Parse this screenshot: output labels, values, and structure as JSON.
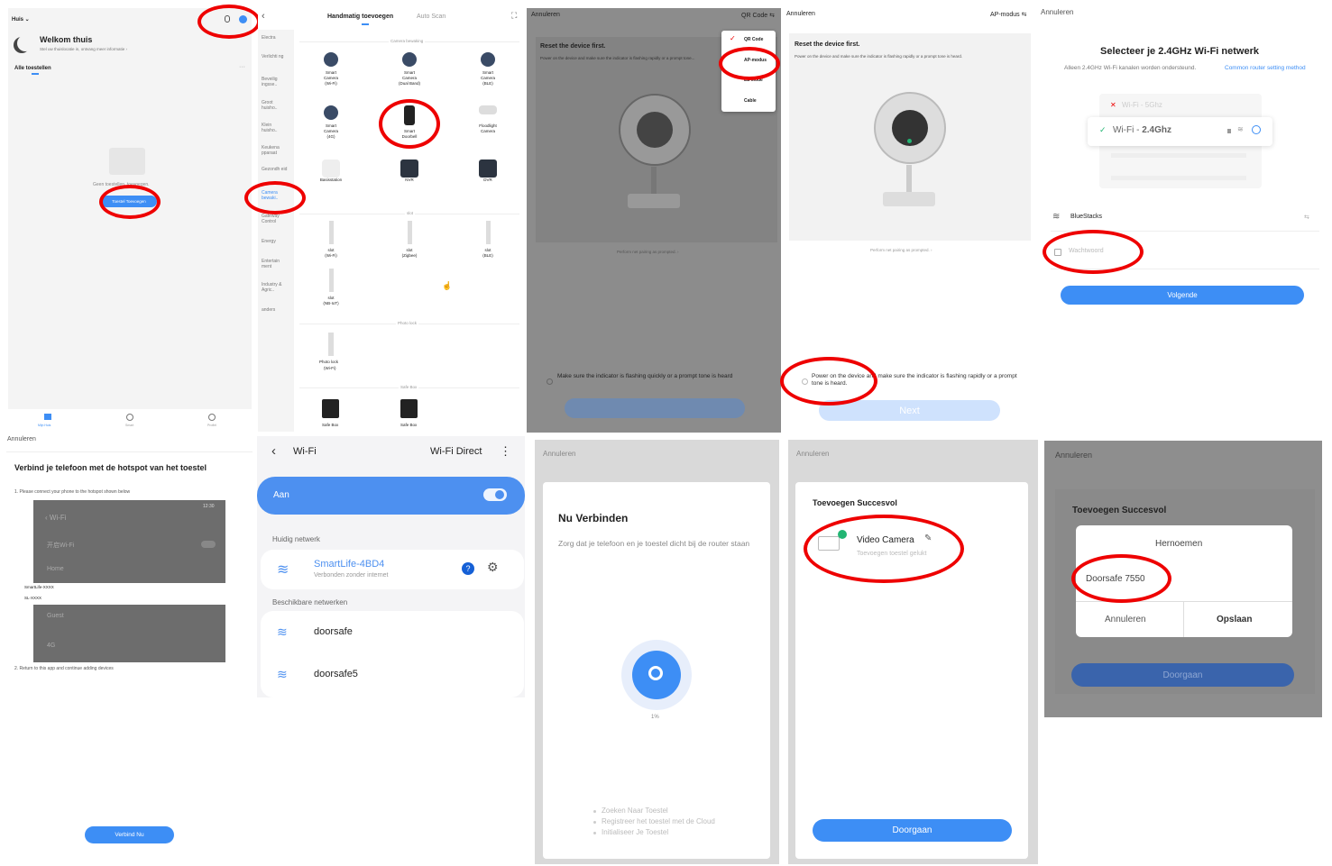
{
  "p1": {
    "home": "Huis ⌄",
    "welcome": "Welkom thuis",
    "sub": "Stel uw thuislocatie in, ontvang meer informatie ›",
    "all": "Alle toestellen",
    "more": "···",
    "empty": "Geen toestellen, toevoegen.",
    "add_btn": "Toestel Toevoegen",
    "nav": [
      "Mijn Huis",
      "Smart",
      "Profiel"
    ]
  },
  "p2": {
    "tab_manual": "Handmatig toevoegen",
    "tab_auto": "Auto Scan",
    "cats": [
      "Electra",
      "Verlichti ng",
      "Beveilig ingsse..",
      "Groot huisho..",
      "Klein huisho..",
      "Keukena pparaat",
      "Gezondh eid",
      "Camera bewaki..",
      "Gateway Control",
      "Energy",
      "Entertain ment",
      "Industry & Agric..",
      "anders"
    ],
    "sec_cam": "Camera bewaking",
    "devices": [
      [
        "Smart",
        "Camera",
        "(Wi-Fi)"
      ],
      [
        "Smart",
        "Camera",
        "(Dual Band)"
      ],
      [
        "Smart",
        "Camera",
        "(BLE)"
      ],
      [
        "Smart",
        "Camera",
        "(4G)"
      ],
      [
        "Smart",
        "Doorbell"
      ],
      [
        "Floodlight",
        "Camera"
      ],
      [
        "Basisstation"
      ],
      [
        "NVR"
      ],
      [
        "DVR"
      ]
    ],
    "sec_slot": "slot",
    "slots": [
      [
        "slot",
        "(Wi-Fi)"
      ],
      [
        "slot",
        "(Zigbee)"
      ],
      [
        "slot",
        "(BLE)"
      ],
      [
        "slot",
        "(NB-IoT)"
      ]
    ],
    "sec_photo": "Photo lock",
    "photo": [
      "Photo lock",
      "(Wi-Fi)"
    ],
    "sec_safe": "Safe Box",
    "safes": [
      "Safe Box",
      "Safe Box"
    ]
  },
  "p3": {
    "cancel": "Annuleren",
    "mode": "QR Code ⇆",
    "reset": "Reset the device first.",
    "desc": "Power on the device and make sure the indicator is flashing rapidly or a prompt tone...",
    "pairing": "Perform net pairing as prompted. ›",
    "check": "Make sure the indicator is flashing quickly or a prompt tone is heard",
    "menu": [
      "QR Code",
      "AP-modus",
      "EZ Mode",
      "Cable"
    ]
  },
  "p4": {
    "cancel": "Annuleren",
    "mode": "AP-modus ⇆",
    "reset": "Reset the device first.",
    "desc": "Power on the device and make sure the indicator is flashing rapidly or a prompt tone is heard.",
    "pairing": "Perform net pairing as prompted. ›",
    "check": "Power on the device and make sure the indicator is flashing rapidly or a prompt tone is heard.",
    "btn": "Next"
  },
  "p5": {
    "cancel": "Annuleren",
    "title": "Selecteer je 2.4GHz Wi-Fi netwerk",
    "sub": "Alleen 2.4GHz Wi-Fi kanalen worden ondersteund.",
    "link": "Common router setting method",
    "wifi5": "Wi-Fi - 5Ghz",
    "wifi24": "Wi-Fi - 2.4Ghz",
    "ssid": "BlueStacks",
    "swap": "⇆",
    "pw": "Wachtwoord",
    "next": "Volgende"
  },
  "p6": {
    "cancel": "Annuleren",
    "title": "Verbind je telefoon met de hotspot van het toestel",
    "step1": "1. Please connect your phone to the hotspot shown below",
    "time": "12:30",
    "wifi": "‹ Wi-Fi",
    "on": "开启Wi-Fi",
    "home": "Home",
    "sl1": "SmartLife-XXXX",
    "sl2": "SL-XXXX",
    "guest": "Guest",
    "g4": "4G",
    "step2": "2. Return to this app and continue adding devices",
    "btn": "Verbind Nu"
  },
  "p7": {
    "back": "‹",
    "title": "Wi-Fi",
    "direct": "Wi-Fi Direct",
    "menu": "⋮",
    "on": "Aan",
    "current": "Huidig netwerk",
    "net": "SmartLife-4BD4",
    "net_sub": "Verbonden zonder internet",
    "avail": "Beschikbare netwerken",
    "n1": "doorsafe",
    "n2": "doorsafe5"
  },
  "p8": {
    "cancel": "Annuleren",
    "title": "Nu Verbinden",
    "sub": "Zorg dat je telefoon en je toestel dicht bij de router staan",
    "pct": "1%",
    "s1": "Zoeken Naar Toestel",
    "s2": "Registreer het toestel met de Cloud",
    "s3": "Initialiseer Je Toestel",
    "progress": 0.01
  },
  "p9": {
    "cancel": "Annuleren",
    "title": "Toevoegen Succesvol",
    "device": "Video Camera",
    "status": "Toevoegen toestel gelukt",
    "btn": "Doorgaan"
  },
  "p10": {
    "cancel": "Annuleren",
    "title": "Toevoegen Succesvol",
    "rename": "Hernoemen",
    "name": "Doorsafe 7550",
    "cancel_btn": "Annuleren",
    "save": "Opslaan",
    "btn": "Doorgaan"
  },
  "colors": {
    "accent": "#3d8ef5",
    "ring": "#e00000",
    "check": "#22b573"
  }
}
